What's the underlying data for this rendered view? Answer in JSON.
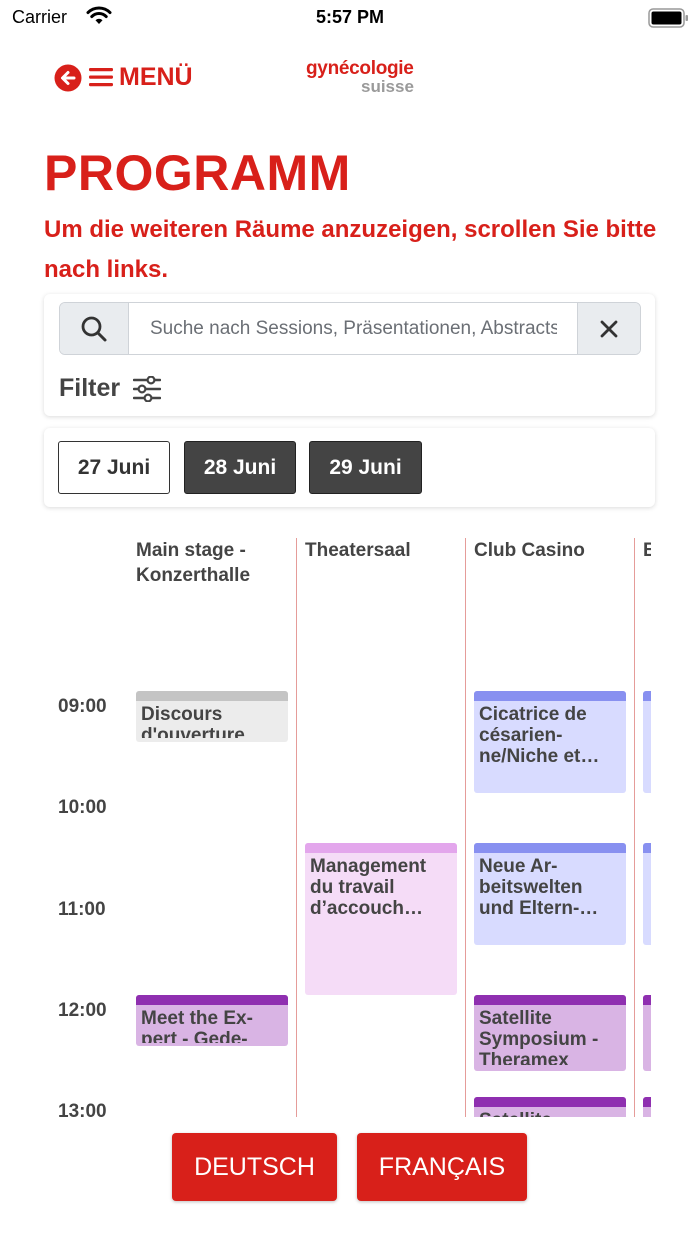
{
  "status_bar": {
    "carrier": "Carrier",
    "time": "5:57 PM"
  },
  "header": {
    "back_icon": "arrow-left-circle-icon",
    "menu_icon": "hamburger-icon",
    "menu_label": "MENÜ",
    "logo_line1": "gynécologie",
    "logo_line2": "suisse"
  },
  "page_title": "PROGRAMM",
  "notice": "Um die weiteren Räume anzuzeigen, scrollen Sie bitte nach links.",
  "search": {
    "placeholder": "Suche nach Sessions, Präsentationen, Abstracts",
    "search_icon": "search-icon",
    "clear_icon": "close-icon"
  },
  "filter": {
    "label": "Filter",
    "icon": "sliders-icon"
  },
  "dates": [
    {
      "label": "27 Juni",
      "selected": true
    },
    {
      "label": "28 Juni",
      "selected": false
    },
    {
      "label": "29 Juni",
      "selected": false
    }
  ],
  "rooms": [
    "Main stage - Konzerthalle",
    "Theatersaal",
    "Club Casino",
    "B"
  ],
  "times": [
    "09:00",
    "10:00",
    "11:00",
    "12:00",
    "13:00"
  ],
  "sessions": [
    {
      "room": "Main stage - Konzerthalle",
      "title": "Discours d'ouverture",
      "start": "09:00",
      "end": "09:30",
      "bar_color": "#c4c4c4",
      "bg_color": "#ececec"
    },
    {
      "room": "Club Casino",
      "title": "Cicatrice de césarien-ne/Niche et…",
      "start": "09:00",
      "end": "10:00",
      "bar_color": "#8890f0",
      "bg_color": "#d8dbff"
    },
    {
      "room": "Theatersaal",
      "title": "Management du travail d’accouch…",
      "start": "10:30",
      "end": "12:00",
      "bar_color": "#e3a6ec",
      "bg_color": "#f5dcf7"
    },
    {
      "room": "Club Casino",
      "title": "Neue Ar-beitswelten und Eltern-…",
      "start": "10:30",
      "end": "11:30",
      "bar_color": "#8890f0",
      "bg_color": "#d8dbff"
    },
    {
      "room": "Main stage - Konzerthalle",
      "title": "Meet the Ex-pert - Gede-",
      "start": "12:00",
      "end": "12:30",
      "bar_color": "#8f2fb0",
      "bg_color": "#d9b4e4"
    },
    {
      "room": "Club Casino",
      "title": "Satellite Symposium - Theramex",
      "start": "12:00",
      "end": "12:45",
      "bar_color": "#8f2fb0",
      "bg_color": "#d9b4e4"
    },
    {
      "room": "Club Casino",
      "title": "Satellite",
      "start": "13:00",
      "end": "14:00",
      "bar_color": "#8f2fb0",
      "bg_color": "#d9b4e4"
    }
  ],
  "languages": [
    "DEUTSCH",
    "FRANÇAIS"
  ],
  "colors": {
    "brand_red": "#d8201a",
    "dark_button": "#444444"
  }
}
